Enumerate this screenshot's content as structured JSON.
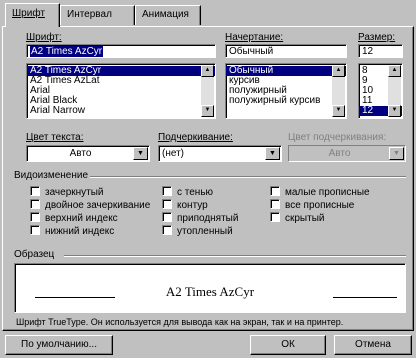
{
  "tabs": [
    {
      "label": "Шрифт",
      "active": true
    },
    {
      "label": "Интервал",
      "active": false
    },
    {
      "label": "Анимация",
      "active": false
    }
  ],
  "font": {
    "label": "Шрифт:",
    "value": "A2 Times AzCyr",
    "items": [
      "A2 Times AzCyr",
      "A2 Times AzLat",
      "Arial",
      "Arial Black",
      "Arial Narrow"
    ],
    "selected": "A2 Times AzCyr"
  },
  "style": {
    "label": "Начертание:",
    "value": "Обычный",
    "items": [
      "Обычный",
      "курсив",
      "полужирный",
      "полужирный курсив"
    ],
    "selected": "Обычный"
  },
  "size": {
    "label": "Размер:",
    "value": "12",
    "items": [
      "8",
      "9",
      "10",
      "11",
      "12"
    ],
    "selected": "12"
  },
  "text_color": {
    "label": "Цвет текста:",
    "value": "Авто"
  },
  "underline": {
    "label": "Подчеркивание:",
    "value": "(нет)"
  },
  "underline_color": {
    "label": "Цвет подчеркивания:",
    "value": "Авто"
  },
  "effects": {
    "label": "Видоизменение",
    "items": [
      "зачеркнутый",
      "двойное зачеркивание",
      "верхний индекс",
      "нижний индекс",
      "с тенью",
      "контур",
      "приподнятый",
      "утопленный",
      "малые прописные",
      "все прописные",
      "скрытый"
    ]
  },
  "preview": {
    "label": "Образец",
    "sample": "A2 Times AzCyr",
    "note": "Шрифт TrueType. Он используется для вывода как на экран, так и на принтер."
  },
  "buttons": {
    "default": "По умолчанию...",
    "ok": "ОК",
    "cancel": "Отмена"
  },
  "icons": {
    "scroll_up": "up-arrow-icon",
    "scroll_down": "down-arrow-icon",
    "dropdown": "chevron-down-icon"
  },
  "colors": {
    "selection": "#000080",
    "face": "#c0c0c0"
  }
}
